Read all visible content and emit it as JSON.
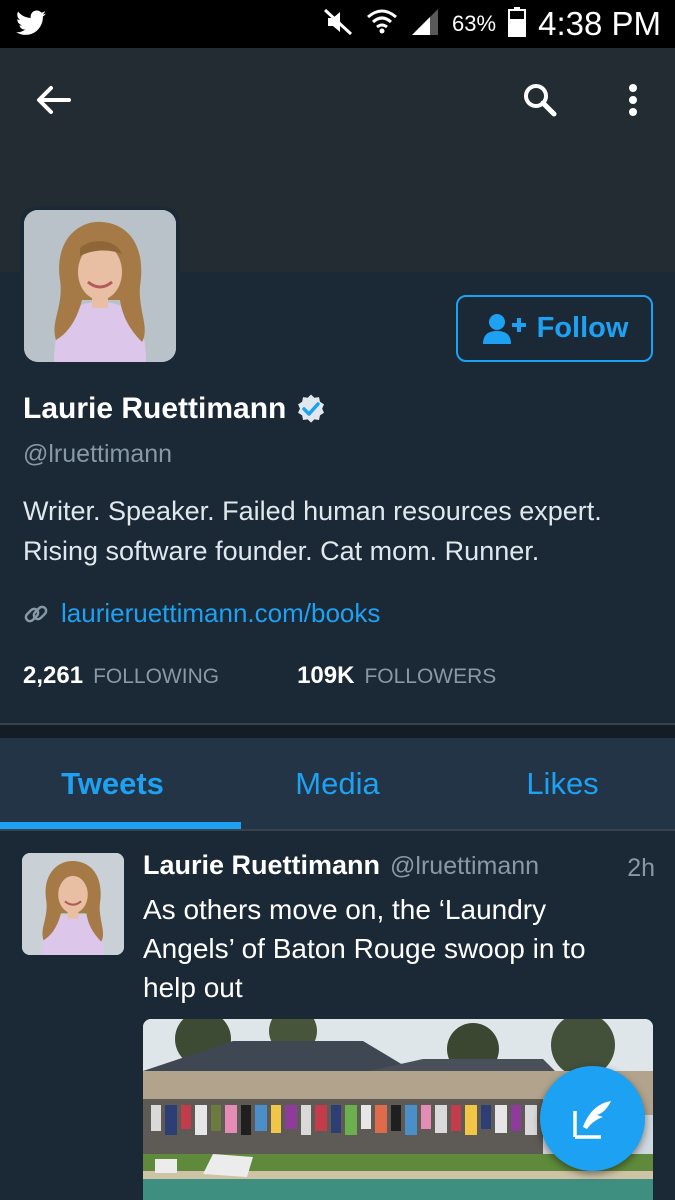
{
  "status_bar": {
    "battery": "63%",
    "time": "4:38 PM",
    "icons": [
      "twitter-bird-icon",
      "mute-icon",
      "wifi-icon",
      "signal-icon",
      "battery-icon"
    ]
  },
  "toolbar": {
    "icons": [
      "back-arrow-icon",
      "search-icon",
      "more-vertical-icon"
    ]
  },
  "profile": {
    "follow_label": "Follow",
    "name": "Laurie Ruettimann",
    "verified": true,
    "handle": "@lruettimann",
    "bio_line1": "Writer. Speaker. Failed human resources expert.",
    "bio_line2": "Rising software founder. Cat mom. Runner.",
    "link": "laurieruettimann.com/books",
    "following_count": "2,261",
    "following_label": "FOLLOWING",
    "followers_count": "109K",
    "followers_label": "FOLLOWERS"
  },
  "tabs": [
    {
      "label": "Tweets",
      "active": true
    },
    {
      "label": "Media",
      "active": false
    },
    {
      "label": "Likes",
      "active": false
    }
  ],
  "tweet": {
    "name": "Laurie Ruettimann",
    "handle": "@lruettimann",
    "time": "2h",
    "text_line1": "As others move on, the ‘Laundry",
    "text_line2": "Angels’ of Baton Rouge swoop in to",
    "text_line3": "help out"
  },
  "colors": {
    "accent": "#1da1f2",
    "background": "#1b2836",
    "banner": "#232b33",
    "tab_bar": "#243447",
    "muted_text": "#8899a6"
  },
  "fab": {
    "icon": "compose-tweet-icon"
  }
}
